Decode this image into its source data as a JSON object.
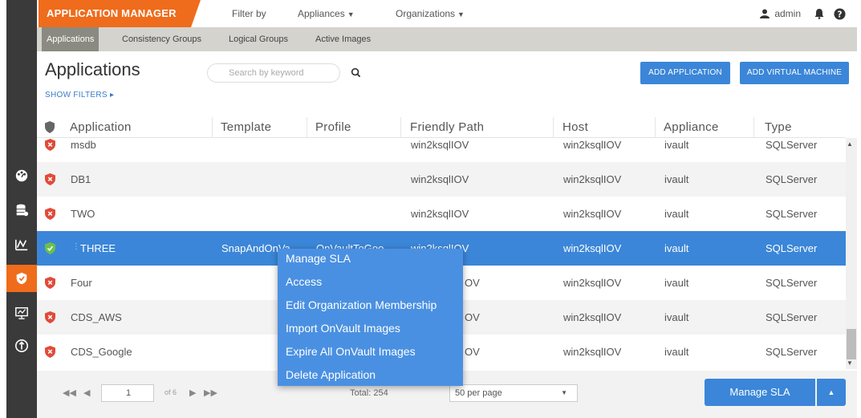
{
  "header": {
    "brand": "APPLICATION MANAGER",
    "filter_by": "Filter by",
    "appliances": "Appliances",
    "organizations": "Organizations",
    "user": "admin"
  },
  "subtabs": [
    "Applications",
    "Consistency Groups",
    "Logical Groups",
    "Active Images"
  ],
  "page": {
    "title": "Applications",
    "show_filters": "SHOW FILTERS ▸",
    "search_placeholder": "Search by keyword",
    "add_application": "ADD APPLICATION",
    "add_vm": "ADD VIRTUAL MACHINE"
  },
  "table": {
    "columns": [
      "Application",
      "Template",
      "Profile",
      "Friendly Path",
      "Host",
      "Appliance",
      "Type"
    ],
    "rows": [
      {
        "status": "red",
        "application": "msdb",
        "template": "",
        "profile": "",
        "friendly_path": "win2ksqlIOV",
        "host": "win2ksqlIOV",
        "appliance": "ivault",
        "type": "SQLServer"
      },
      {
        "status": "red",
        "application": "DB1",
        "template": "",
        "profile": "",
        "friendly_path": "win2ksqlIOV",
        "host": "win2ksqlIOV",
        "appliance": "ivault",
        "type": "SQLServer"
      },
      {
        "status": "red",
        "application": "TWO",
        "template": "",
        "profile": "",
        "friendly_path": "win2ksqlIOV",
        "host": "win2ksqlIOV",
        "appliance": "ivault",
        "type": "SQLServer"
      },
      {
        "status": "green",
        "application": "THREE",
        "template": "SnapAndOnVa",
        "profile": "OnVaultToGoo",
        "friendly_path": "win2ksqlIOV",
        "host": "win2ksqlIOV",
        "appliance": "ivault",
        "type": "SQLServer"
      },
      {
        "status": "red",
        "application": "Four",
        "template": "",
        "profile": "",
        "friendly_path": "OV",
        "host": "win2ksqlIOV",
        "appliance": "ivault",
        "type": "SQLServer"
      },
      {
        "status": "red",
        "application": "CDS_AWS",
        "template": "",
        "profile": "",
        "friendly_path": "OV",
        "host": "win2ksqlIOV",
        "appliance": "ivault",
        "type": "SQLServer"
      },
      {
        "status": "red",
        "application": "CDS_Google",
        "template": "",
        "profile": "",
        "friendly_path": "OV",
        "host": "win2ksqlIOV",
        "appliance": "ivault",
        "type": "SQLServer"
      }
    ]
  },
  "context_menu": [
    "Manage SLA",
    "Access",
    "Edit Organization Membership",
    "Import OnVault Images",
    "Expire All OnVault Images",
    "Delete Application"
  ],
  "footer": {
    "page": "1",
    "of": "of 6",
    "total": "Total: 254",
    "per_page": "50 per page",
    "manage_sla": "Manage SLA"
  },
  "colors": {
    "brand": "#ef6c1c",
    "accent": "#3b86d8",
    "status_red": "#e04b3a",
    "status_green": "#6cc04a"
  },
  "icons": [
    "dashboard-icon",
    "database-icon",
    "chart-icon",
    "shield-icon",
    "monitor-icon",
    "settings-icon"
  ]
}
